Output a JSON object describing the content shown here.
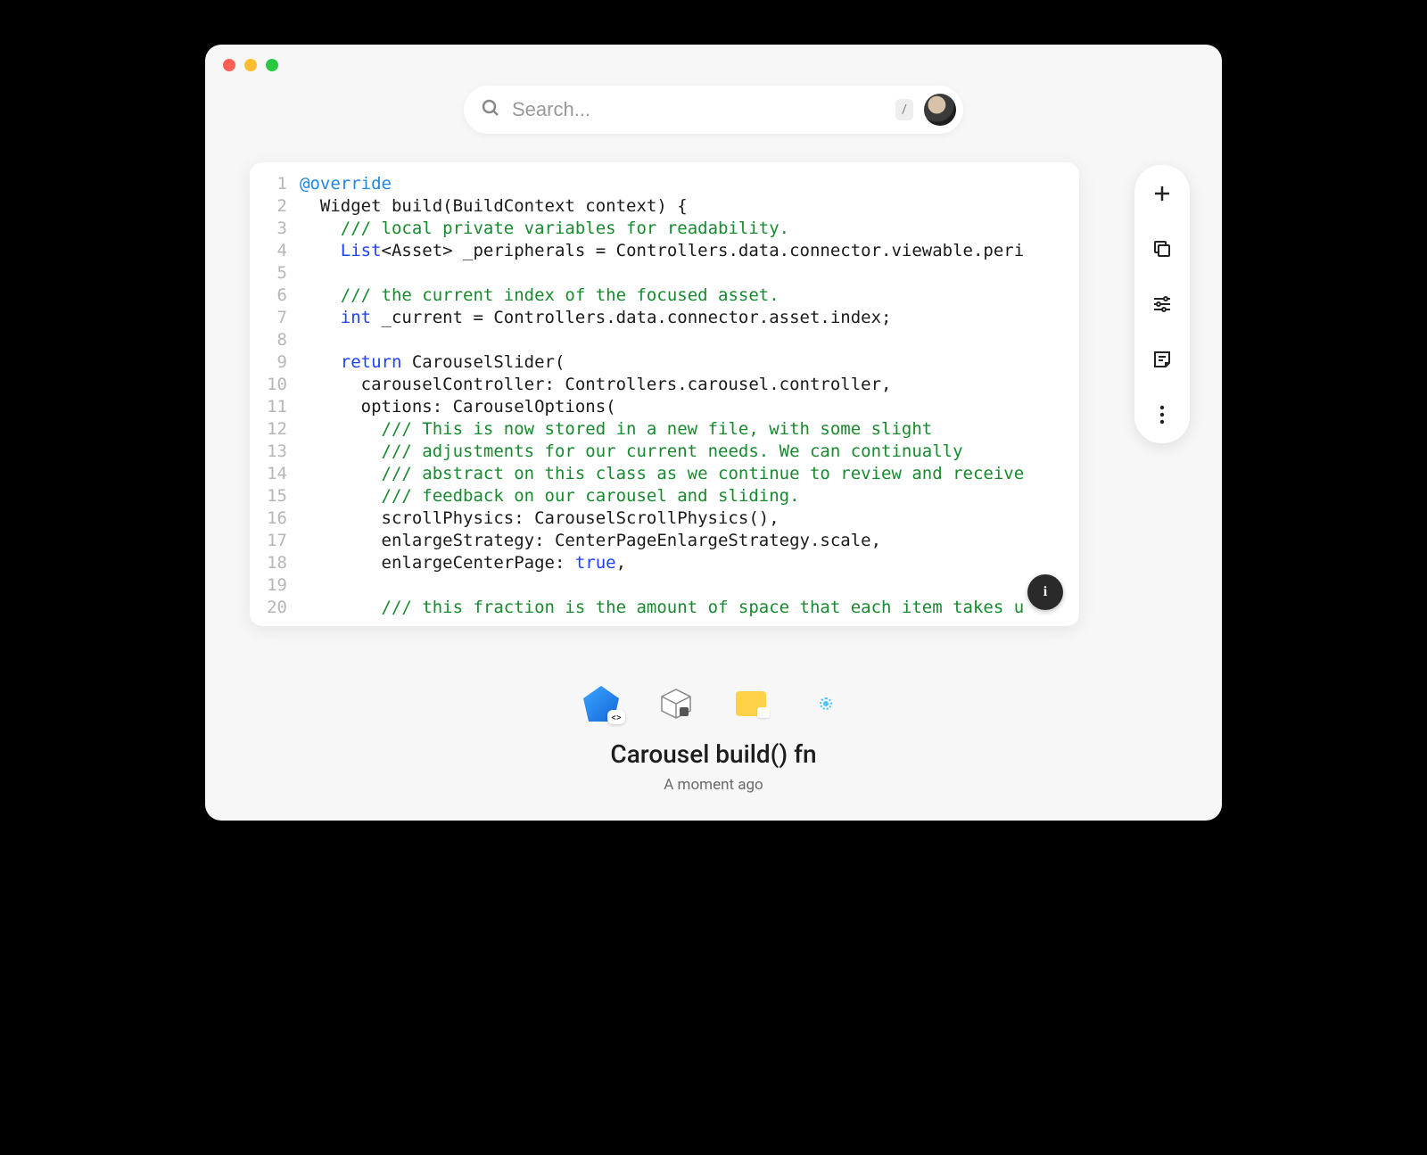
{
  "search": {
    "placeholder": "Search...",
    "shortcut": "/"
  },
  "code": {
    "lines": [
      [
        {
          "t": "ann",
          "v": "@override"
        }
      ],
      [
        {
          "t": "p",
          "v": "  Widget build(BuildContext context) {"
        }
      ],
      [
        {
          "t": "p",
          "v": "    "
        },
        {
          "t": "cmt",
          "v": "/// local private variables for readability."
        }
      ],
      [
        {
          "t": "p",
          "v": "    "
        },
        {
          "t": "type",
          "v": "List"
        },
        {
          "t": "p",
          "v": "<Asset> _peripherals = Controllers.data.connector.viewable.peri"
        }
      ],
      [
        {
          "t": "p",
          "v": ""
        }
      ],
      [
        {
          "t": "p",
          "v": "    "
        },
        {
          "t": "cmt",
          "v": "/// the current index of the focused asset."
        }
      ],
      [
        {
          "t": "p",
          "v": "    "
        },
        {
          "t": "type",
          "v": "int"
        },
        {
          "t": "p",
          "v": " _current = Controllers.data.connector.asset.index;"
        }
      ],
      [
        {
          "t": "p",
          "v": ""
        }
      ],
      [
        {
          "t": "p",
          "v": "    "
        },
        {
          "t": "kw",
          "v": "return"
        },
        {
          "t": "p",
          "v": " CarouselSlider("
        }
      ],
      [
        {
          "t": "p",
          "v": "      carouselController: Controllers.carousel.controller,"
        }
      ],
      [
        {
          "t": "p",
          "v": "      options: CarouselOptions("
        }
      ],
      [
        {
          "t": "p",
          "v": "        "
        },
        {
          "t": "cmt",
          "v": "/// This is now stored in a new file, with some slight"
        }
      ],
      [
        {
          "t": "p",
          "v": "        "
        },
        {
          "t": "cmt",
          "v": "/// adjustments for our current needs. We can continually"
        }
      ],
      [
        {
          "t": "p",
          "v": "        "
        },
        {
          "t": "cmt",
          "v": "/// abstract on this class as we continue to review and receive"
        }
      ],
      [
        {
          "t": "p",
          "v": "        "
        },
        {
          "t": "cmt",
          "v": "/// feedback on our carousel and sliding."
        }
      ],
      [
        {
          "t": "p",
          "v": "        scrollPhysics: CarouselScrollPhysics(),"
        }
      ],
      [
        {
          "t": "p",
          "v": "        enlargeStrategy: CenterPageEnlargeStrategy.scale,"
        }
      ],
      [
        {
          "t": "p",
          "v": "        enlargeCenterPage: "
        },
        {
          "t": "bool",
          "v": "true"
        },
        {
          "t": "p",
          "v": ","
        }
      ],
      [
        {
          "t": "p",
          "v": ""
        }
      ],
      [
        {
          "t": "p",
          "v": "        "
        },
        {
          "t": "cmt",
          "v": "/// this fraction is the amount of space that each item takes u"
        }
      ]
    ]
  },
  "sidebar": {
    "add": "add-icon",
    "copy": "copy-icon",
    "tune": "tune-icon",
    "note": "note-icon",
    "more": "more-icon"
  },
  "snippet": {
    "title": "Carousel build() fn",
    "time": "A moment ago"
  },
  "info_button": "i"
}
